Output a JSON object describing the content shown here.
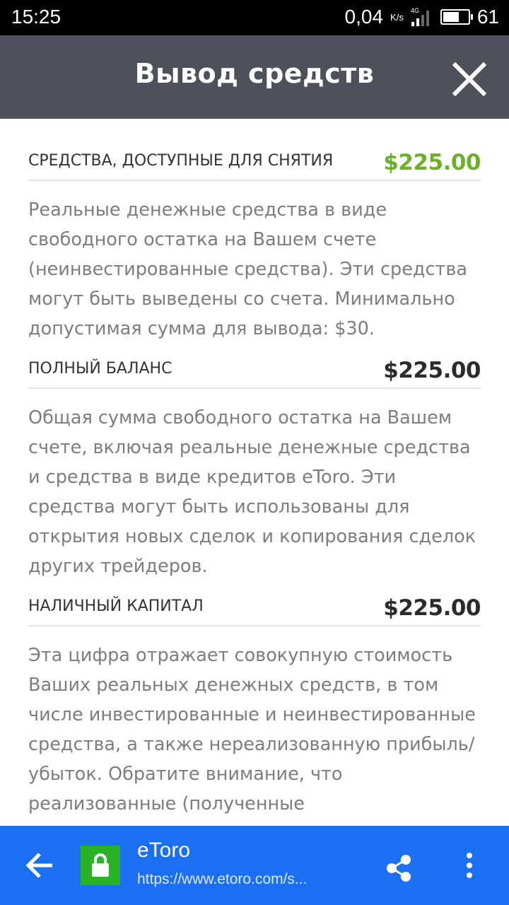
{
  "status_bar": {
    "time": "15:25",
    "network_speed": "0,04",
    "speed_unit": "K/s",
    "network_type": "4G",
    "battery": "61"
  },
  "header": {
    "title": "Вывод средств",
    "close_icon": "close-icon"
  },
  "sections": [
    {
      "label": "СРЕДСТВА, ДОСТУПНЫЕ ДЛЯ СНЯТИЯ",
      "amount": "$225.00",
      "amount_color": "#6db12a",
      "description": "Реальные денежные средства в виде свободного остатка на Вашем счете (неинвестированные средства). Эти средства могут быть выведены со счета. Минимально допустимая сумма для вывода: $30."
    },
    {
      "label": "ПОЛНЫЙ БАЛАНС",
      "amount": "$225.00",
      "description": "Общая сумма свободного остатка на Вашем счете, включая реальные денежные средства и средства в виде кредитов eToro. Эти средства могут быть использованы для открытия новых сделок и копирования сделок других трейдеров."
    },
    {
      "label": "НАЛИЧНЫЙ КАПИТАЛ",
      "amount": "$225.00",
      "description": "Эта цифра отражает совокупную стоимость Ваших реальных денежных средств, в том числе инвестированные и неинвестированные средства, а также нереализованную прибыль/убыток. Обратите внимание, что реализованные (полученные"
    }
  ],
  "browser_bar": {
    "site_name": "eToro",
    "url": "https://www.etoro.com/s...",
    "bar_color": "#1b6ff3",
    "lock_color": "#2bb327"
  }
}
